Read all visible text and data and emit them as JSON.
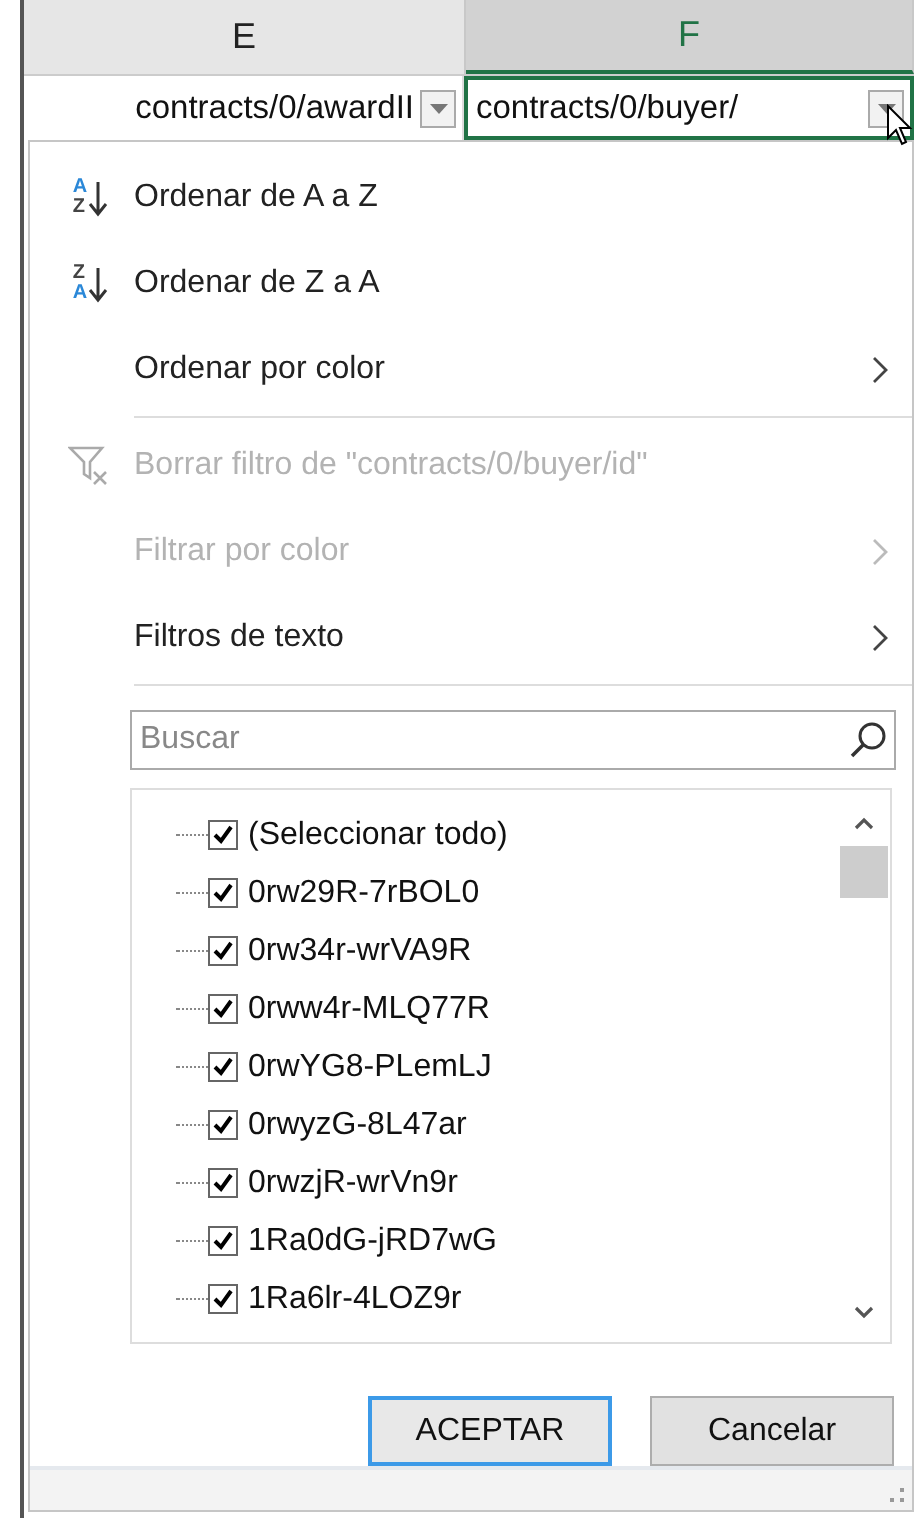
{
  "columns": [
    {
      "label": "E",
      "selected": false
    },
    {
      "label": "F",
      "selected": true
    }
  ],
  "header_cells": [
    {
      "text": "contracts/0/awardII",
      "selected": false
    },
    {
      "text": "contracts/0/buyer/",
      "selected": true
    }
  ],
  "menu": [
    {
      "kind": "sort",
      "label": "Ordenar de A a Z",
      "icon_top": "A",
      "icon_bottom": "Z",
      "disabled": false,
      "submenu": false
    },
    {
      "kind": "sort",
      "label": "Ordenar de Z a A",
      "icon_top": "Z",
      "icon_bottom": "A",
      "disabled": false,
      "submenu": false
    },
    {
      "kind": "item",
      "label": "Ordenar por color",
      "disabled": false,
      "submenu": true
    },
    {
      "kind": "separator"
    },
    {
      "kind": "clear",
      "label": "Borrar filtro de \"contracts/0/buyer/id\"",
      "disabled": true,
      "submenu": false
    },
    {
      "kind": "item",
      "label": "Filtrar por color",
      "disabled": true,
      "submenu": true
    },
    {
      "kind": "item",
      "label": "Filtros de texto",
      "disabled": false,
      "submenu": true
    },
    {
      "kind": "separator"
    }
  ],
  "search": {
    "placeholder": "Buscar"
  },
  "values": [
    {
      "label": "(Seleccionar todo)",
      "checked": true
    },
    {
      "label": "0rw29R-7rBOL0",
      "checked": true
    },
    {
      "label": "0rw34r-wrVA9R",
      "checked": true
    },
    {
      "label": "0rww4r-MLQ77R",
      "checked": true
    },
    {
      "label": "0rwYG8-PLemLJ",
      "checked": true
    },
    {
      "label": "0rwyzG-8L47ar",
      "checked": true
    },
    {
      "label": "0rwzjR-wrVn9r",
      "checked": true
    },
    {
      "label": "1Ra0dG-jRD7wG",
      "checked": true
    },
    {
      "label": "1Ra6lr-4LOZ9r",
      "checked": true
    }
  ],
  "buttons": [
    {
      "label": "ACEPTAR",
      "default": true
    },
    {
      "label": "Cancelar",
      "default": false
    }
  ]
}
